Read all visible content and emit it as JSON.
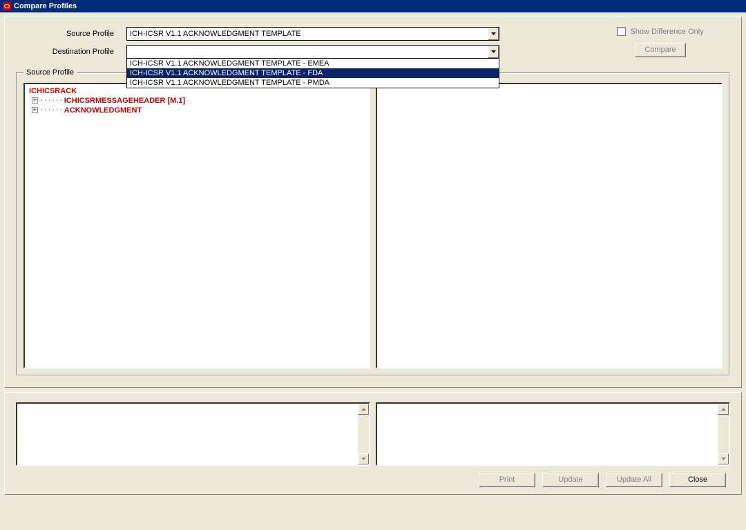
{
  "window": {
    "title": "Compare Profiles"
  },
  "form": {
    "source_label": "Source Profile",
    "destination_label": "Destination Profile",
    "source_value": "ICH-ICSR V1.1 ACKNOWLEDGMENT TEMPLATE",
    "destination_value": "",
    "destination_options": [
      "ICH-ICSR V1.1 ACKNOWLEDGMENT TEMPLATE - EMEA",
      "ICH-ICSR V1.1 ACKNOWLEDGMENT TEMPLATE - FDA",
      "ICH-ICSR V1.1 ACKNOWLEDGMENT TEMPLATE - PMDA"
    ],
    "destination_selected_index": 1,
    "show_diff_label": "Show Difference Only",
    "compare_label": "Compare"
  },
  "group": {
    "title": "Source Profile",
    "tree": {
      "root": "ICHICSRACK",
      "children": [
        "ICHICSRMESSAGEHEADER [M.1]",
        "ACKNOWLEDGMENT"
      ]
    }
  },
  "footer": {
    "print": "Print",
    "update": "Update",
    "update_all": "Update All",
    "close": "Close"
  }
}
